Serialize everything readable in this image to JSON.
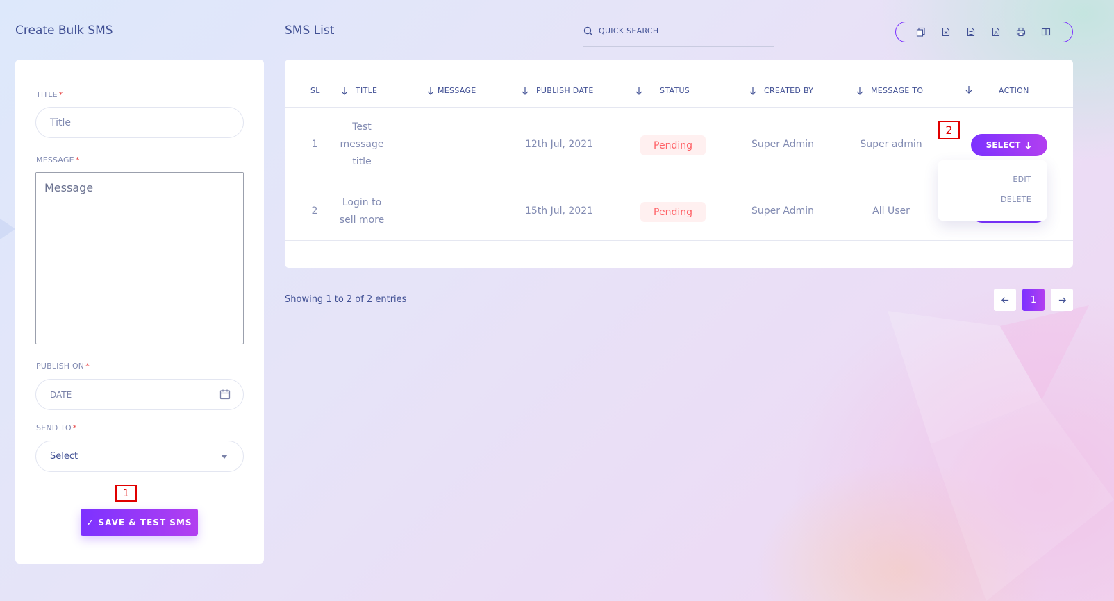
{
  "left_panel": {
    "heading": "Create Bulk SMS",
    "fields": {
      "title_label": "TITLE",
      "title_placeholder": "Title",
      "message_label": "MESSAGE",
      "message_placeholder": "Message",
      "publish_label": "PUBLISH ON",
      "publish_placeholder": "DATE",
      "send_to_label": "SEND TO",
      "send_to_value": "Select",
      "required_mark": "*"
    },
    "save_button": {
      "icon": "check-icon",
      "check": "✓",
      "label": "SAVE & TEST SMS"
    }
  },
  "annotations": {
    "marker_1": "1",
    "marker_2": "2"
  },
  "list": {
    "heading": "SMS List",
    "search_placeholder": "QUICK SEARCH",
    "export_icons": [
      "copy-icon",
      "excel-icon",
      "csv-icon",
      "pdf-icon",
      "print-icon",
      "columns-icon"
    ],
    "columns": {
      "sl": "SL",
      "title": "TITLE",
      "message": "MESSAGE",
      "publish_date": "PUBLISH DATE",
      "status": "STATUS",
      "created_by": "CREATED BY",
      "message_to": "MESSAGE TO",
      "action": "ACTION"
    },
    "rows": [
      {
        "sl": "1",
        "title_lines": [
          "Test",
          "message",
          "title"
        ],
        "message": "",
        "publish_date": "12th Jul, 2021",
        "status": "Pending",
        "created_by": "Super Admin",
        "message_to": "Super admin",
        "action": "SELECT"
      },
      {
        "sl": "2",
        "title_lines": [
          "Login to",
          "sell more"
        ],
        "message": "",
        "publish_date": "15th Jul, 2021",
        "status": "Pending",
        "created_by": "Super Admin",
        "message_to": "All User",
        "action": "SELECT"
      }
    ],
    "dropdown_items": [
      "EDIT",
      "DELETE"
    ],
    "showing_text": "Showing 1 to 2 of 2 entries",
    "pagination": {
      "current": "1"
    }
  },
  "colors": {
    "accent": "#7c32ff",
    "accent_end": "#b23ff0",
    "text": "#415094",
    "muted": "#828bb2",
    "status_pending_bg": "#fff0f0",
    "status_pending_text": "#ff6166",
    "required": "#e84b4b"
  }
}
